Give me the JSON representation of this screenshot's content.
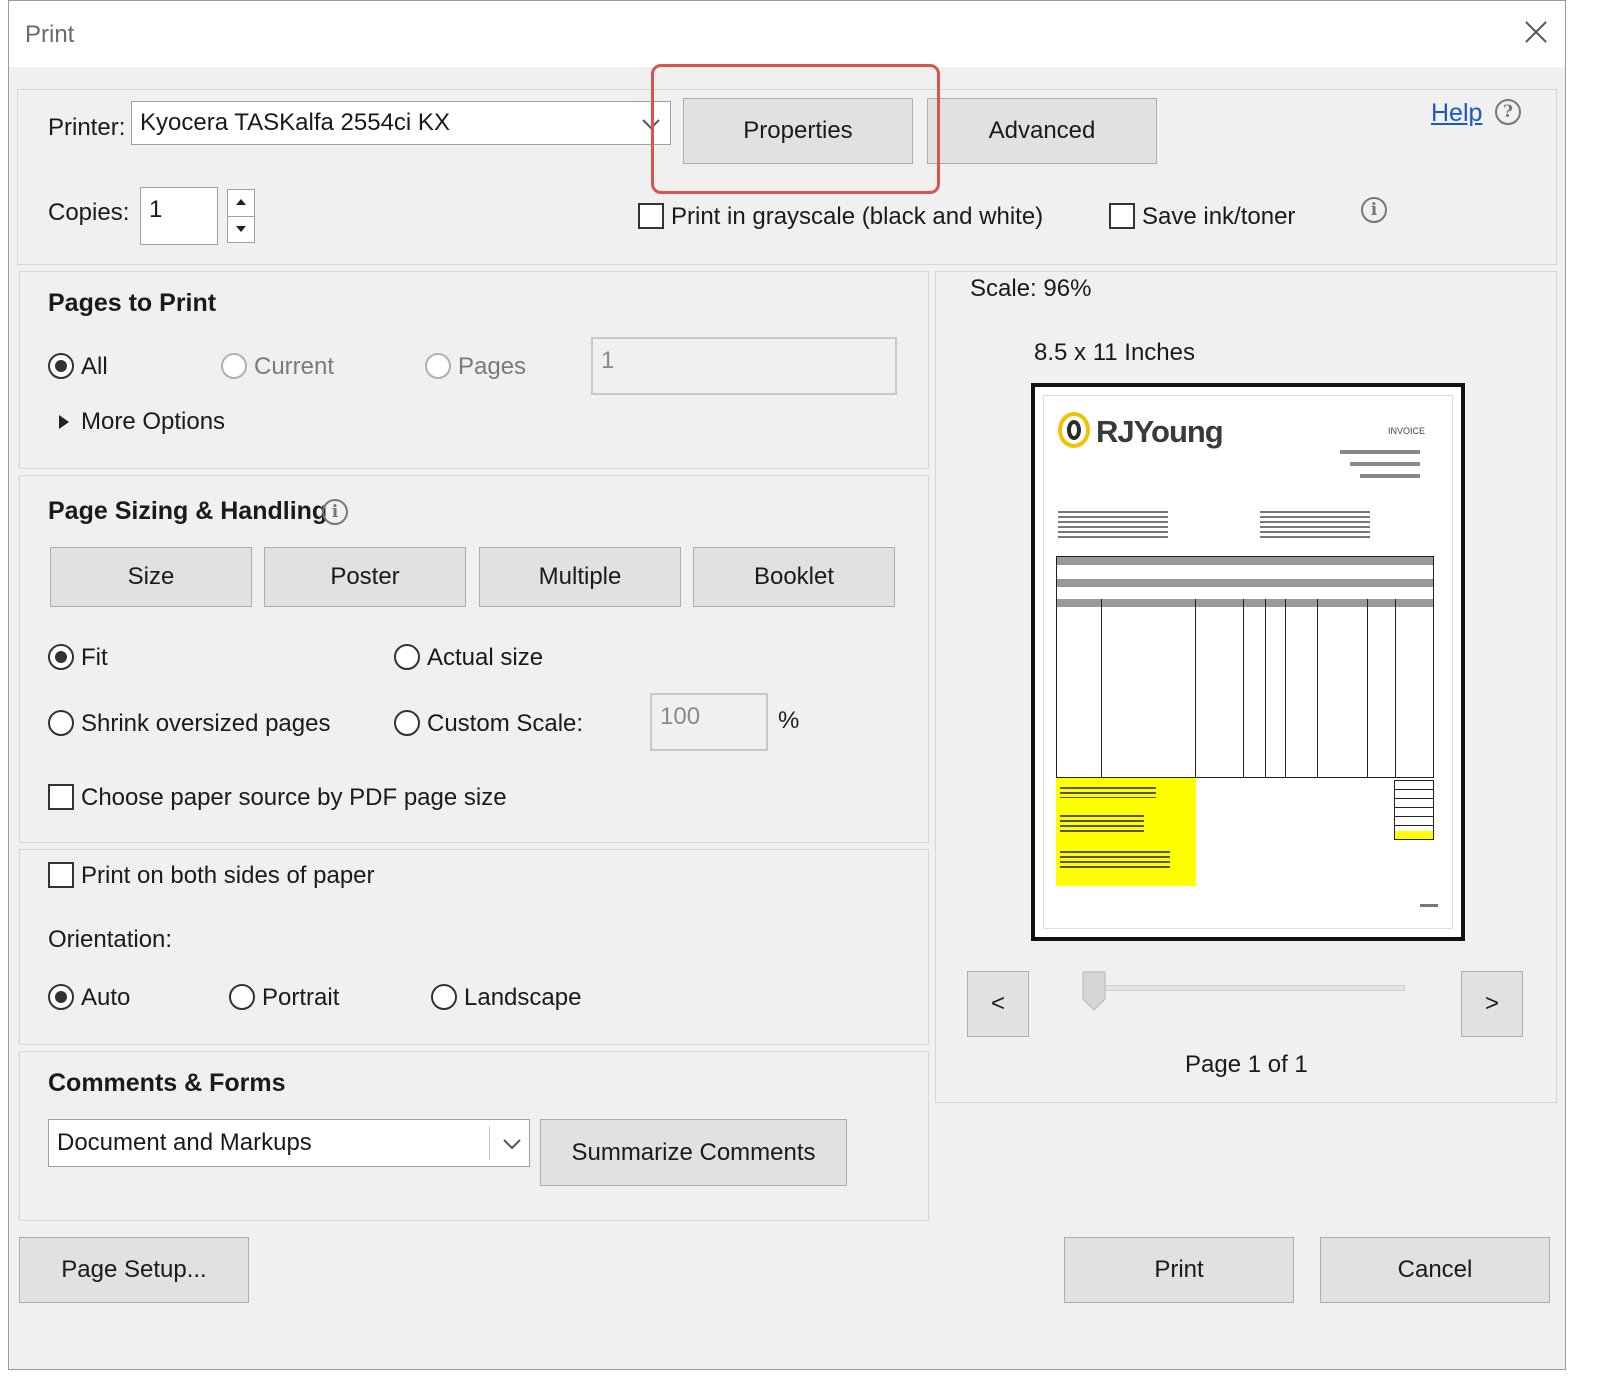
{
  "dialog": {
    "title": "Print",
    "close_icon": "close-icon"
  },
  "printer": {
    "label": "Printer:",
    "value": "Kyocera TASKalfa 2554ci KX",
    "properties": "Properties",
    "advanced": "Advanced",
    "help": "Help"
  },
  "copies": {
    "label": "Copies:",
    "value": "1"
  },
  "options": {
    "grayscale": "Print in grayscale (black and white)",
    "save_ink": "Save ink/toner"
  },
  "pages_to_print": {
    "heading": "Pages to Print",
    "all": "All",
    "current": "Current",
    "pages": "Pages",
    "pages_value": "1",
    "more": "More Options"
  },
  "sizing": {
    "heading": "Page Sizing & Handling",
    "size": "Size",
    "poster": "Poster",
    "multiple": "Multiple",
    "booklet": "Booklet",
    "fit": "Fit",
    "actual": "Actual size",
    "shrink": "Shrink oversized pages",
    "custom": "Custom Scale:",
    "custom_value": "100",
    "percent": "%",
    "paper_source": "Choose paper source by PDF page size"
  },
  "duplex": {
    "label": "Print on both sides of paper",
    "orientation": "Orientation:",
    "auto": "Auto",
    "portrait": "Portrait",
    "landscape": "Landscape"
  },
  "comments": {
    "heading": "Comments & Forms",
    "select": "Document and Markups",
    "summarize": "Summarize Comments"
  },
  "preview": {
    "scale": "Scale:  96%",
    "paper": "8.5 x 11 Inches",
    "prev": "<",
    "next": ">",
    "page_status": "Page 1 of 1",
    "logo_text": "RJYoung",
    "doc_title": "INVOICE"
  },
  "footer": {
    "page_setup": "Page Setup...",
    "print": "Print",
    "cancel": "Cancel"
  },
  "colors": {
    "highlight": "#d9534f",
    "link": "#1a57c8",
    "invoice_highlight": "#ffff00",
    "logo_ring": "#f2c200"
  }
}
